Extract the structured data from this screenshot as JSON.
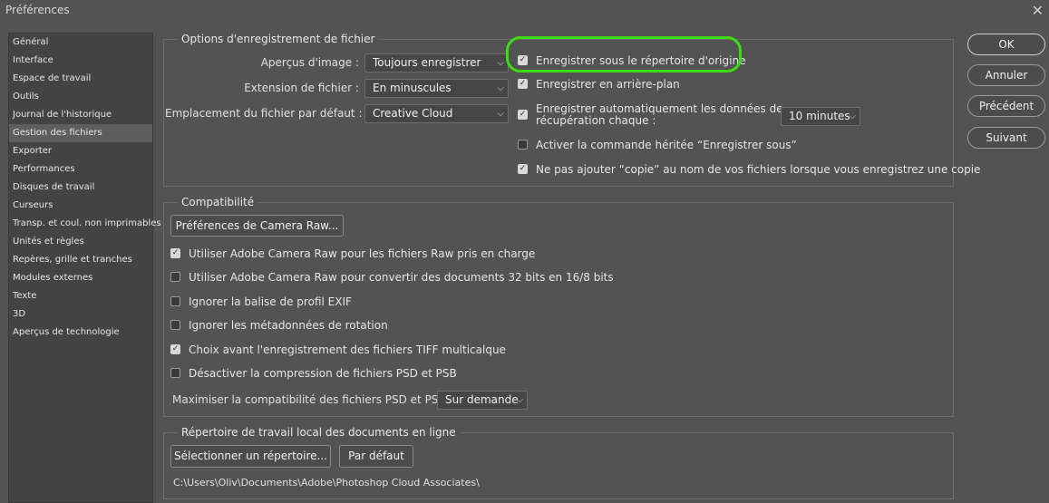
{
  "window": {
    "title": "Préférences"
  },
  "sidebar": {
    "items": [
      {
        "label": "Général"
      },
      {
        "label": "Interface"
      },
      {
        "label": "Espace de travail"
      },
      {
        "label": "Outils"
      },
      {
        "label": "Journal de l'historique"
      },
      {
        "label": "Gestion des fichiers"
      },
      {
        "label": "Exporter"
      },
      {
        "label": "Performances"
      },
      {
        "label": "Disques de travail"
      },
      {
        "label": "Curseurs"
      },
      {
        "label": "Transp. et coul. non imprimables"
      },
      {
        "label": "Unités et règles"
      },
      {
        "label": "Repères, grille et tranches"
      },
      {
        "label": "Modules externes"
      },
      {
        "label": "Texte"
      },
      {
        "label": "3D"
      },
      {
        "label": "Aperçus de technologie"
      }
    ],
    "active": "Gestion des fichiers"
  },
  "save_options": {
    "title": "Options d'enregistrement de fichier",
    "preview_label": "Aperçus d'image :",
    "preview_value": "Toujours enregistrer",
    "extension_label": "Extension de fichier :",
    "extension_value": "En minuscules",
    "location_label": "Emplacement du fichier par défaut :",
    "location_value": "Creative Cloud",
    "save_original_dir": {
      "label": "Enregistrer sous le répertoire d'origine",
      "checked": true
    },
    "save_background": {
      "label": "Enregistrer en arrière-plan",
      "checked": true
    },
    "autosave": {
      "label_line1": "Enregistrer automatiquement les données de",
      "label_line2": "récupération chaque :",
      "checked": true
    },
    "autosave_interval": "10 minutes",
    "legacy_save_as": {
      "label": "Activer la commande héritée “Enregistrer sous”",
      "checked": false
    },
    "no_copy_suffix": {
      "label": "Ne pas ajouter “copie” au nom de vos fichiers lorsque vous enregistrez une copie",
      "checked": true
    }
  },
  "compatibility": {
    "title": "Compatibilité",
    "camera_raw_button": "Préférences de Camera Raw...",
    "options": [
      {
        "label": "Utiliser Adobe Camera Raw pour les fichiers Raw pris en charge",
        "checked": true
      },
      {
        "label": "Utiliser Adobe Camera Raw pour convertir des documents 32 bits en 16/8 bits",
        "checked": false
      },
      {
        "label": "Ignorer la balise de profil EXIF",
        "checked": false
      },
      {
        "label": "Ignorer les métadonnées de rotation",
        "checked": false
      },
      {
        "label": "Choix avant l'enregistrement des fichiers TIFF multicalque",
        "checked": true
      },
      {
        "label": "Désactiver la compression de fichiers PSD et PSB",
        "checked": false
      }
    ],
    "maximize_label": "Maximiser la compatibilité des fichiers PSD et PSB :",
    "maximize_value": "Sur demande"
  },
  "cloud_dir": {
    "title": "Répertoire de travail local des documents en ligne",
    "select_button": "Sélectionner un répertoire...",
    "default_button": "Par défaut",
    "path": "C:\\Users\\Oliv\\Documents\\Adobe\\Photoshop Cloud Associates\\"
  },
  "actions": {
    "ok": "OK",
    "cancel": "Annuler",
    "previous": "Précédent",
    "next": "Suivant"
  },
  "colors": {
    "background": "#535353",
    "sidebar": "#434343",
    "highlight": "#3ddc10"
  }
}
